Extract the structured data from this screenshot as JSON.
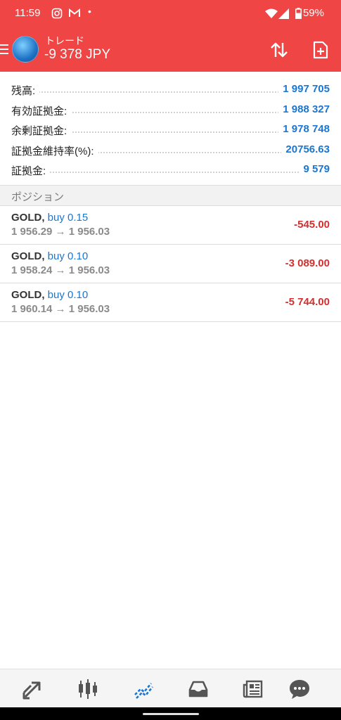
{
  "status_bar": {
    "time": "11:59",
    "battery": "59%",
    "dot": "•"
  },
  "header": {
    "title": "トレード",
    "balance": "-9 378 JPY"
  },
  "account": [
    {
      "label": "残高:",
      "value": "1 997 705"
    },
    {
      "label": "有効証拠金:",
      "value": "1 988 327"
    },
    {
      "label": "余剰証拠金:",
      "value": "1 978 748"
    },
    {
      "label": "証拠金維持率(%):",
      "value": "20756.63"
    },
    {
      "label": "証拠金:",
      "value": "9 579"
    }
  ],
  "positions_section": {
    "title": "ポジション"
  },
  "positions": [
    {
      "symbol": "GOLD,",
      "side": "buy 0.15",
      "prices": "1 956.29 → 1 956.03",
      "profit": "-545.00"
    },
    {
      "symbol": "GOLD,",
      "side": "buy 0.10",
      "prices": "1 958.24 → 1 956.03",
      "profit": "-3 089.00"
    },
    {
      "symbol": "GOLD,",
      "side": "buy 0.10",
      "prices": "1 960.14 → 1 956.03",
      "profit": "-5 744.00"
    }
  ],
  "colors": {
    "header": "#ef4545",
    "accent": "#1976d2",
    "loss": "#d32f2f"
  },
  "bottom_nav": [
    "quotes-icon",
    "chart-icon",
    "trade-icon",
    "history-icon",
    "news-icon",
    "chat-icon"
  ]
}
